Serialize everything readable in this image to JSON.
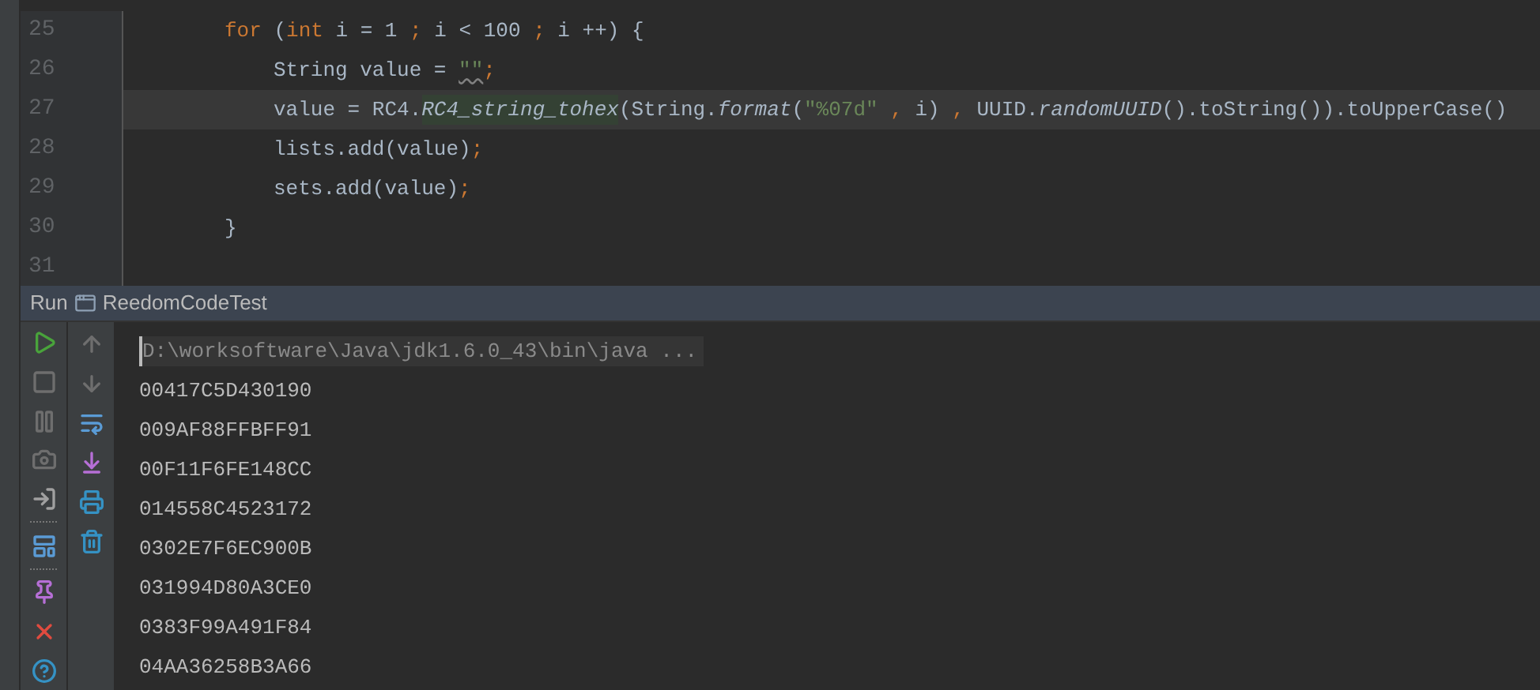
{
  "editor": {
    "lines": [
      {
        "number": "25",
        "current": false,
        "tokens": [
          {
            "text": "for",
            "kind": "keyword"
          },
          {
            "text": " (",
            "kind": "plain"
          },
          {
            "text": "int",
            "kind": "keyword"
          },
          {
            "text": " i = 1 ",
            "kind": "plain"
          },
          {
            "text": ";",
            "kind": "keyword"
          },
          {
            "text": " i < 100 ",
            "kind": "plain"
          },
          {
            "text": ";",
            "kind": "keyword"
          },
          {
            "text": " i ++) {",
            "kind": "plain"
          }
        ],
        "children": [
          {
            "number": "26",
            "current": false,
            "tokens": [
              {
                "text": "String value = ",
                "kind": "plain"
              },
              {
                "text": "\"\"",
                "kind": "warning-string"
              },
              {
                "text": ";",
                "kind": "keyword"
              }
            ]
          },
          {
            "number": "27",
            "current": true,
            "tokens": [
              {
                "text": "value = RC4.",
                "kind": "plain"
              },
              {
                "text": "RC4_string_tohex",
                "kind": "highlighted-static"
              },
              {
                "text": "(String.",
                "kind": "plain"
              },
              {
                "text": "format",
                "kind": "static"
              },
              {
                "text": "(",
                "kind": "plain"
              },
              {
                "text": "\"%07d\"",
                "kind": "string"
              },
              {
                "text": " ,",
                "kind": "keyword"
              },
              {
                "text": " i) ",
                "kind": "plain"
              },
              {
                "text": ",",
                "kind": "keyword"
              },
              {
                "text": " UUID.",
                "kind": "plain"
              },
              {
                "text": "randomUUID",
                "kind": "static"
              },
              {
                "text": "().toString()).toUpperCase()",
                "kind": "plain"
              }
            ]
          },
          {
            "number": "28",
            "current": false,
            "tokens": [
              {
                "text": "lists.add(value)",
                "kind": "plain"
              },
              {
                "text": ";",
                "kind": "keyword"
              }
            ]
          },
          {
            "number": "29",
            "current": false,
            "tokens": [
              {
                "text": "sets.add(value)",
                "kind": "plain"
              },
              {
                "text": ";",
                "kind": "keyword"
              }
            ]
          }
        ]
      },
      {
        "number": "30",
        "current": false,
        "tokens": [
          {
            "text": "}",
            "kind": "plain"
          }
        ]
      },
      {
        "number": "31",
        "current": false
      }
    ]
  },
  "run_panel": {
    "label": "Run",
    "config": "ReedomCodeTest",
    "console": [
      {
        "text": "D:\\worksoftware\\Java\\jdk1.6.0_43\\bin\\java ...",
        "kind": "command"
      },
      {
        "text": "00417C5D430190",
        "kind": "output"
      },
      {
        "text": "009AF88FFBFF91",
        "kind": "output"
      },
      {
        "text": "00F11F6FE148CC",
        "kind": "output"
      },
      {
        "text": "014558C4523172",
        "kind": "output"
      },
      {
        "text": "0302E7F6EC900B",
        "kind": "output"
      },
      {
        "text": "031994D80A3CE0",
        "kind": "output"
      },
      {
        "text": "0383F99A491F84",
        "kind": "output"
      },
      {
        "text": "04AA36258B3A66",
        "kind": "output"
      }
    ]
  }
}
